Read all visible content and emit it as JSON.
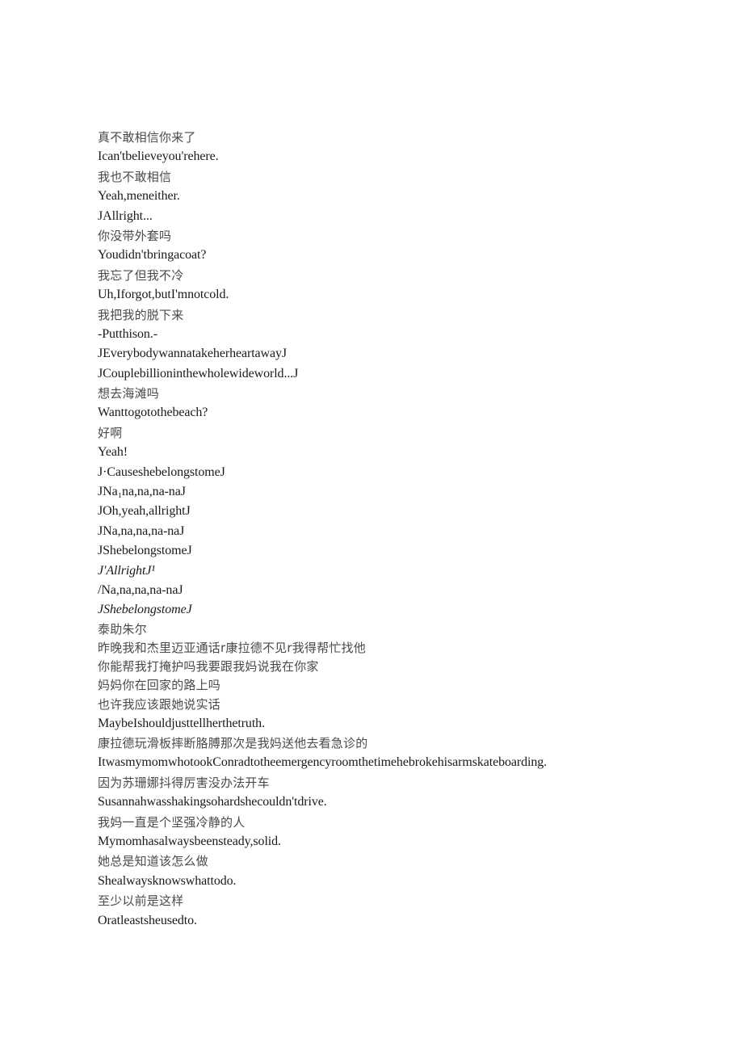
{
  "document": {
    "type": "bilingual-subtitle-transcript",
    "page_background": "#ffffff",
    "zh_text_color": "#4a4a4a",
    "en_text_color": "#1a1a1a",
    "music_note_glyph": "J",
    "lines": [
      {
        "id": 1,
        "lang": "zh",
        "text": "真不敢相信你来了"
      },
      {
        "id": 2,
        "lang": "en",
        "text": "Ican'tbelieveyou'rehere."
      },
      {
        "id": 3,
        "lang": "zh",
        "text": "我也不敢相信"
      },
      {
        "id": 4,
        "lang": "en",
        "text": "Yeah,meneither."
      },
      {
        "id": 5,
        "lang": "lyric",
        "text": "JAllright..."
      },
      {
        "id": 6,
        "lang": "zh",
        "text": "你没带外套吗"
      },
      {
        "id": 7,
        "lang": "en",
        "text": "Youdidn'tbringacoat?"
      },
      {
        "id": 8,
        "lang": "zh",
        "text": "我忘了但我不冷"
      },
      {
        "id": 9,
        "lang": "en",
        "text": "Uh,Iforgot,butI'mnotcold."
      },
      {
        "id": 10,
        "lang": "zh",
        "text": "我把我的脱下来"
      },
      {
        "id": 11,
        "lang": "en",
        "text": "-Putthison.-"
      },
      {
        "id": 12,
        "lang": "lyric",
        "text": "JEverybodywannatakeherheartawayJ"
      },
      {
        "id": 13,
        "lang": "lyric",
        "text": "JCouplebillioninthewholewideworld...J"
      },
      {
        "id": 14,
        "lang": "zh",
        "text": "想去海滩吗"
      },
      {
        "id": 15,
        "lang": "en",
        "text": "Wanttogotothebeach?"
      },
      {
        "id": 16,
        "lang": "zh",
        "text": "好啊"
      },
      {
        "id": 17,
        "lang": "en",
        "text": "Yeah!"
      },
      {
        "id": 18,
        "lang": "lyric",
        "text": "J·CauseshebelongstomeJ"
      },
      {
        "id": 19,
        "lang": "lyric",
        "text": "JNa₁na,na,na-naJ"
      },
      {
        "id": 20,
        "lang": "lyric",
        "text": "JOh,yeah,allrightJ"
      },
      {
        "id": 21,
        "lang": "lyric",
        "text": "JNa,na,na,na-naJ"
      },
      {
        "id": 22,
        "lang": "lyric",
        "text": "JShebelongstomeJ"
      },
      {
        "id": 23,
        "lang": "lyric",
        "text": "J'AllrightJ¹",
        "italic": true
      },
      {
        "id": 24,
        "lang": "lyric",
        "text": "/Na,na,na,na-naJ"
      },
      {
        "id": 25,
        "lang": "lyric",
        "text": "JShebelongstomeJ",
        "italic": true
      },
      {
        "id": 26,
        "lang": "zh",
        "text": "泰助朱尔",
        "tight": true
      },
      {
        "id": 27,
        "lang": "zh",
        "text": "昨晚我和杰里迈亚通话r康拉德不见r我得帮忙找他",
        "tight": true
      },
      {
        "id": 28,
        "lang": "zh",
        "text": "你能帮我打掩护吗我要跟我妈说我在你家",
        "tight": true
      },
      {
        "id": 29,
        "lang": "zh",
        "text": "妈妈你在回家的路上吗",
        "tight": true
      },
      {
        "id": 30,
        "lang": "zh",
        "text": "也许我应该跟她说实话",
        "tight": true
      },
      {
        "id": 31,
        "lang": "en",
        "text": "MaybeIshouldjusttellherthetruth."
      },
      {
        "id": 32,
        "lang": "zh",
        "text": "康拉德玩滑板摔断胳膊那次是我妈送他去看急诊的"
      },
      {
        "id": 33,
        "lang": "en",
        "text": "ItwasmymomwhotookConradtotheemergencyroomthetimehebrokehisarmskateboarding."
      },
      {
        "id": 34,
        "lang": "zh",
        "text": "因为苏珊娜抖得厉害没办法开车"
      },
      {
        "id": 35,
        "lang": "en",
        "text": "Susannahwasshakingsohardshecouldn'tdrive."
      },
      {
        "id": 36,
        "lang": "zh",
        "text": "我妈一直是个坚强冷静的人"
      },
      {
        "id": 37,
        "lang": "en",
        "text": "Mymomhasalwaysbeensteady,solid."
      },
      {
        "id": 38,
        "lang": "zh",
        "text": "她总是知道该怎么做"
      },
      {
        "id": 39,
        "lang": "en",
        "text": "Shealwaysknowswhattodo."
      },
      {
        "id": 40,
        "lang": "zh",
        "text": "至少以前是这样"
      },
      {
        "id": 41,
        "lang": "en",
        "text": "Oratleastsheusedto."
      }
    ]
  }
}
